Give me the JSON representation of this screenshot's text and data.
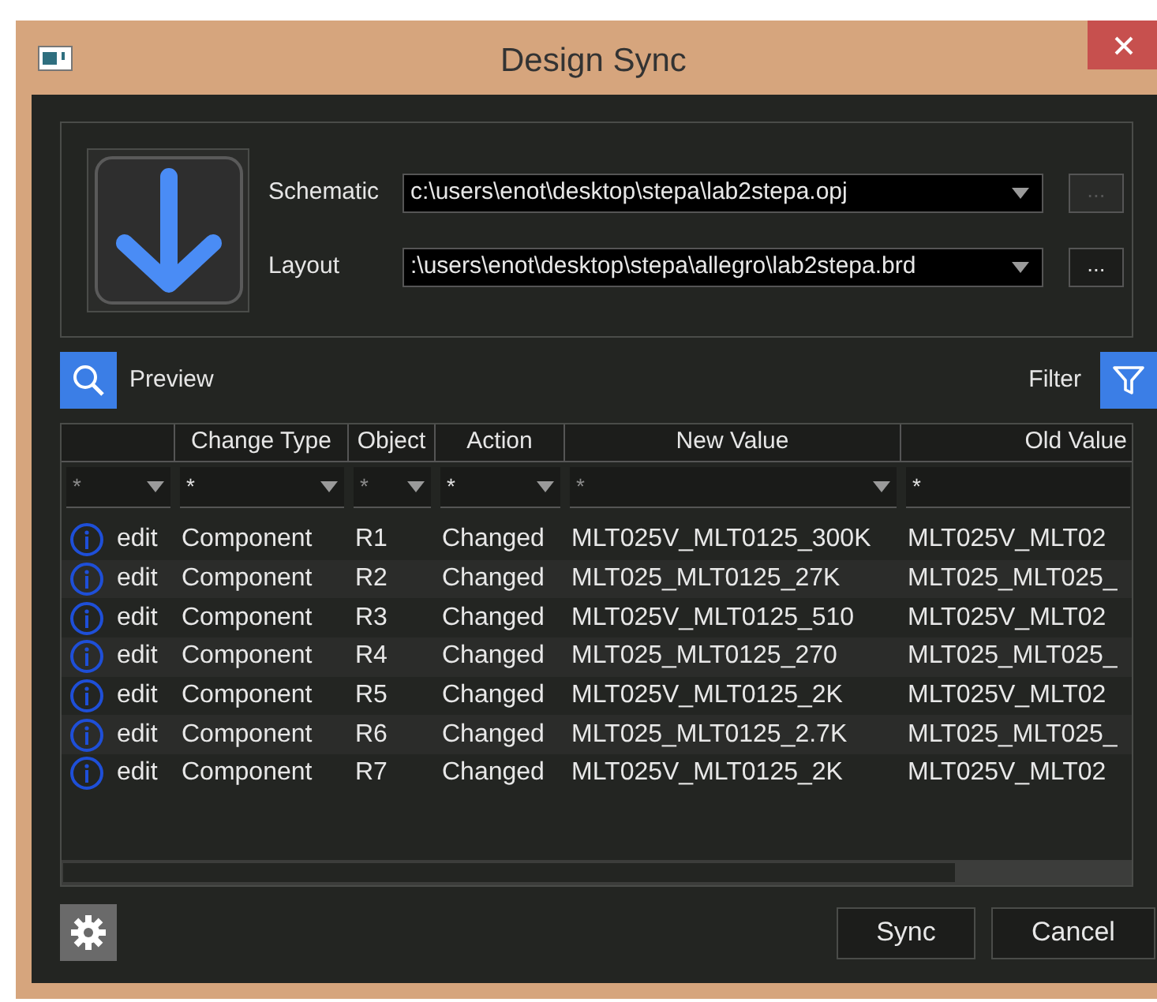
{
  "window": {
    "title": "Design Sync"
  },
  "source": {
    "schematic_label": "Schematic",
    "schematic_value": "c:\\users\\enot\\desktop\\stepa\\lab2stepa.opj",
    "schematic_browse": "...",
    "layout_label": "Layout",
    "layout_value": ":\\users\\enot\\desktop\\stepa\\allegro\\lab2stepa.brd",
    "layout_browse": "..."
  },
  "preview": {
    "label": "Preview"
  },
  "filter": {
    "label": "Filter"
  },
  "table": {
    "columns": [
      "",
      "Change Type",
      "Object",
      "Action",
      "New Value",
      "Old Value"
    ],
    "filters": [
      "*",
      "*",
      "*",
      "*",
      "*",
      "*"
    ],
    "rows": [
      {
        "type": "edit",
        "change_type": "Component",
        "object": "R1",
        "action": "Changed",
        "new_value": "MLT025V_MLT0125_300K",
        "old_value": "MLT025V_MLT02"
      },
      {
        "type": "edit",
        "change_type": "Component",
        "object": "R2",
        "action": "Changed",
        "new_value": "MLT025_MLT0125_27K",
        "old_value": "MLT025_MLT025_"
      },
      {
        "type": "edit",
        "change_type": "Component",
        "object": "R3",
        "action": "Changed",
        "new_value": "MLT025V_MLT0125_510",
        "old_value": "MLT025V_MLT02"
      },
      {
        "type": "edit",
        "change_type": "Component",
        "object": "R4",
        "action": "Changed",
        "new_value": "MLT025_MLT0125_270",
        "old_value": "MLT025_MLT025_"
      },
      {
        "type": "edit",
        "change_type": "Component",
        "object": "R5",
        "action": "Changed",
        "new_value": "MLT025V_MLT0125_2K",
        "old_value": "MLT025V_MLT02"
      },
      {
        "type": "edit",
        "change_type": "Component",
        "object": "R6",
        "action": "Changed",
        "new_value": "MLT025_MLT0125_2.7K",
        "old_value": "MLT025_MLT025_"
      },
      {
        "type": "edit",
        "change_type": "Component",
        "object": "R7",
        "action": "Changed",
        "new_value": "MLT025V_MLT0125_2K",
        "old_value": "MLT025V_MLT02"
      }
    ]
  },
  "buttons": [
    "Sync",
    "Cancel"
  ]
}
